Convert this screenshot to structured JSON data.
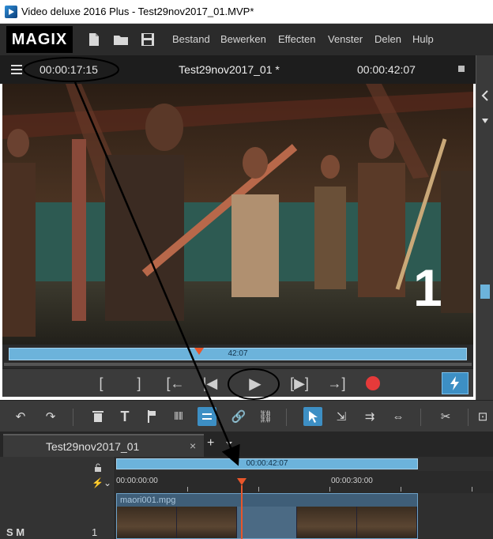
{
  "window": {
    "title": "Video deluxe 2016 Plus - Test29nov2017_01.MVP*"
  },
  "menubar": {
    "logo": "MAGIX",
    "items": [
      "Bestand",
      "Bewerken",
      "Effecten",
      "Venster",
      "Delen",
      "Hulp"
    ],
    "icons": [
      "new-file-icon",
      "open-folder-icon",
      "save-icon"
    ]
  },
  "preview": {
    "current_time": "00:00:17:15",
    "project_title": "Test29nov2017_01 *",
    "total_time": "00:00:42:07",
    "track_number": "1",
    "scrub_label": "42:07",
    "scrub_position_fraction": 0.42
  },
  "transport": {
    "buttons": [
      {
        "name": "mark-in-button",
        "glyph": "["
      },
      {
        "name": "mark-out-button",
        "glyph": "]"
      },
      {
        "name": "jump-to-in-button",
        "glyph": "[←"
      },
      {
        "name": "previous-marker-button",
        "glyph": "|◀"
      },
      {
        "name": "play-button",
        "glyph": "▶"
      },
      {
        "name": "next-frame-button",
        "glyph": "[▶]"
      },
      {
        "name": "jump-to-out-button",
        "glyph": "→]"
      }
    ],
    "record_color": "#e53a3a",
    "accent_color": "#3d8fc4"
  },
  "toolbar": {
    "tools": [
      "undo-icon",
      "redo-icon",
      "delete-icon",
      "text-icon",
      "marker-icon",
      "split-icon",
      "snap-icon",
      "link-icon",
      "unlink-icon",
      "mouse-mode-icon",
      "range-select-icon",
      "track-select-icon",
      "stretch-icon",
      "cut-tool-icon"
    ]
  },
  "tabs": {
    "active_label": "Test29nov2017_01",
    "close": "×",
    "add": "+"
  },
  "timeline": {
    "range_label": "00:00:42:07",
    "ruler_start": "00:00:00:00",
    "ruler_mid": "00:00:30:00",
    "clip_name": "maori001.mpg",
    "track_controls": "S M",
    "track_number": "1",
    "playhead_fraction": 0.415
  }
}
